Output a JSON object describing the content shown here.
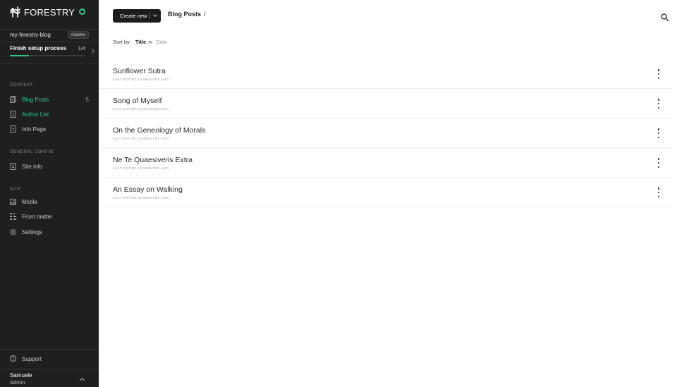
{
  "sidebar": {
    "brand": "FORESTRY",
    "site_name": "my-forestry-blog",
    "branch": "master",
    "setup": {
      "title": "Finish setup process",
      "count": "1/4",
      "progress_fraction": 0.25
    },
    "sections": {
      "content": "Content",
      "general_config": "General Config",
      "site": "Site"
    },
    "content_items": [
      {
        "label": "Blog Posts",
        "count": "5",
        "icon": "document-stack-icon",
        "active": true
      },
      {
        "label": "Author List",
        "icon": "document-icon",
        "active": true
      },
      {
        "label": "Info Page",
        "icon": "document-icon",
        "active": false
      }
    ],
    "config_items": [
      {
        "label": "Site Info",
        "icon": "document-icon"
      }
    ],
    "site_items": [
      {
        "label": "Media",
        "icon": "image-icon"
      },
      {
        "label": "Front matter",
        "icon": "front-matter-icon"
      },
      {
        "label": "Settings",
        "icon": "gear-icon"
      }
    ],
    "support": "Support",
    "user": {
      "name": "Samuele",
      "role": "Admin"
    },
    "colors": {
      "accent": "#2ec98a",
      "background": "#1f1f1f"
    }
  },
  "main": {
    "create_button": "Create new",
    "breadcrumb": {
      "title": "Blog Posts",
      "separator": "/"
    },
    "sort": {
      "label": "Sort by:",
      "active": "Title",
      "other": "Date"
    },
    "posts": [
      {
        "title": "Sunflower Sutra",
        "meta": "Last edited 13 minutes ago"
      },
      {
        "title": "Song of Myself",
        "meta": "Last edited 13 minutes ago"
      },
      {
        "title": "On the Geneology of Morals",
        "meta": "Last edited 13 minutes ago"
      },
      {
        "title": "Ne Te Quaesiveris Extra",
        "meta": "Last edited 13 minutes ago"
      },
      {
        "title": "An Essay on Walking",
        "meta": "Last edited 13 minutes ago"
      }
    ]
  }
}
